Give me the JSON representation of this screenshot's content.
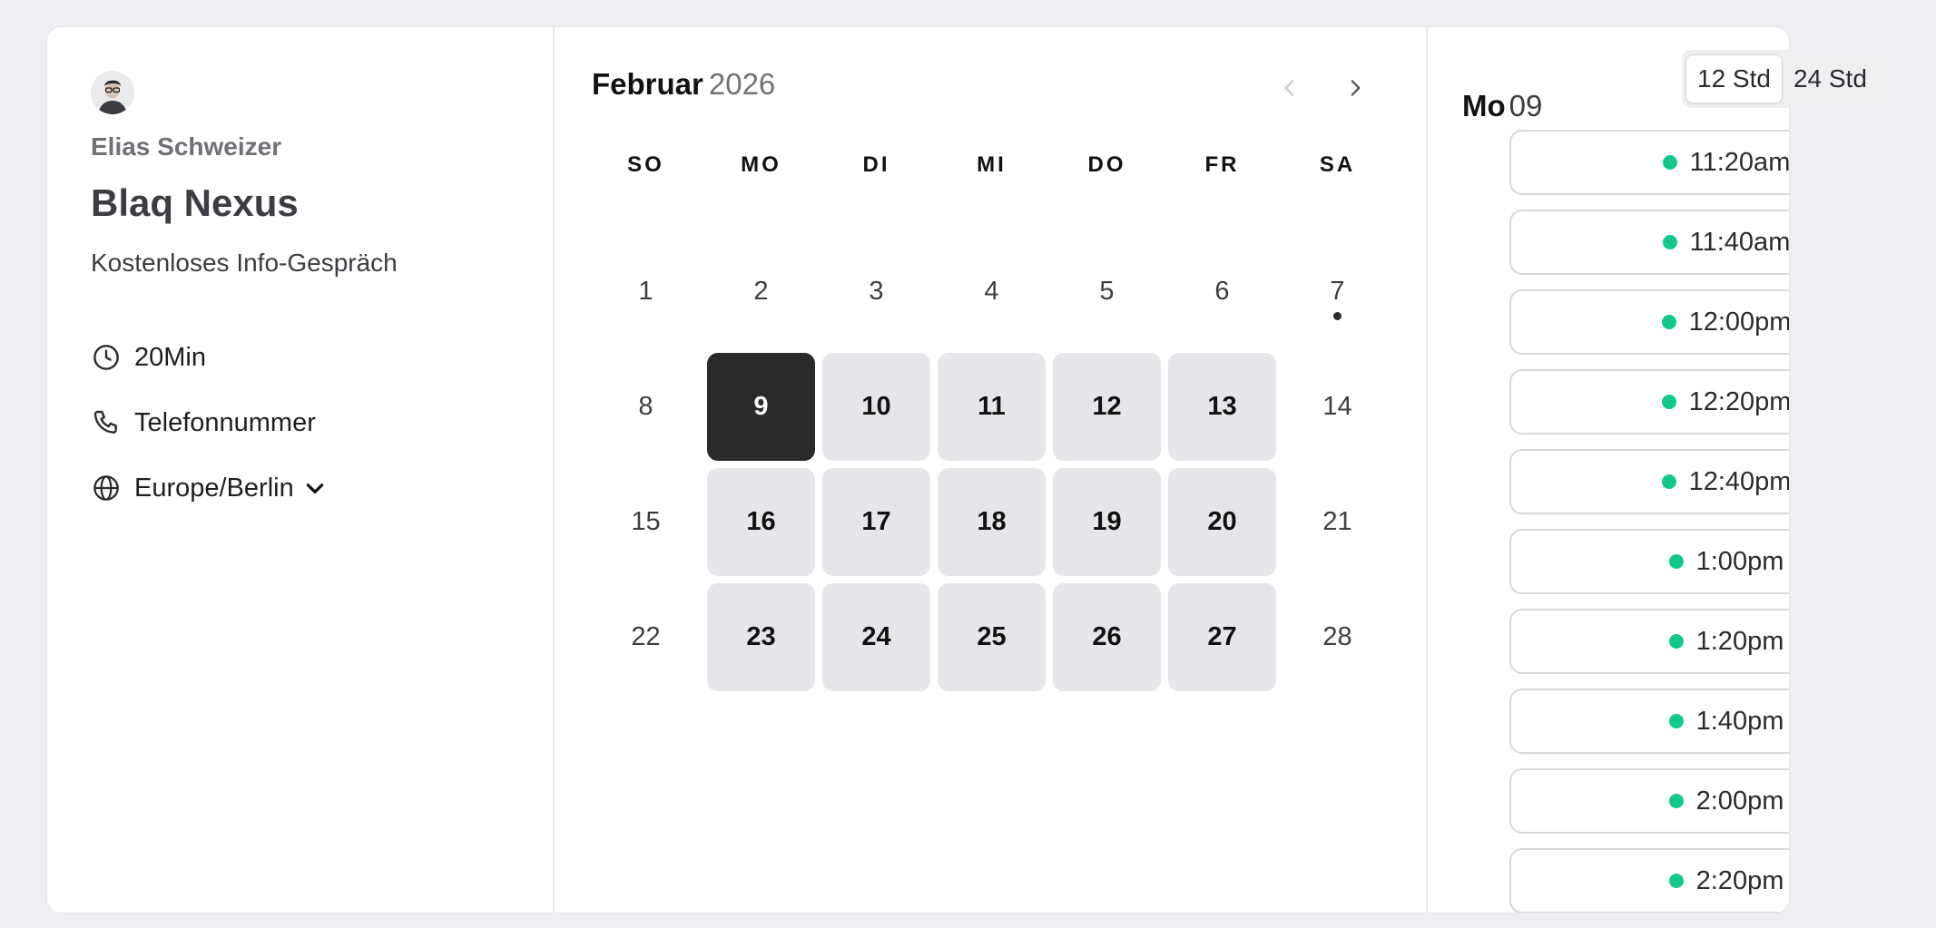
{
  "host": {
    "name": "Elias Schweizer",
    "event_title": "Blaq Nexus",
    "event_description": "Kostenloses Info-Gespräch"
  },
  "details": {
    "duration": "20Min",
    "location": "Telefonnummer",
    "timezone": "Europe/Berlin"
  },
  "calendar": {
    "month": "Februar",
    "year": "2026",
    "weekdays": [
      "SO",
      "MO",
      "DI",
      "MI",
      "DO",
      "FR",
      "SA"
    ],
    "weeks": [
      [
        {
          "d": "1"
        },
        {
          "d": "2"
        },
        {
          "d": "3"
        },
        {
          "d": "4"
        },
        {
          "d": "5"
        },
        {
          "d": "6"
        },
        {
          "d": "7",
          "today": true
        }
      ],
      [
        {
          "d": "8"
        },
        {
          "d": "9",
          "state": "selected"
        },
        {
          "d": "10",
          "state": "available"
        },
        {
          "d": "11",
          "state": "available"
        },
        {
          "d": "12",
          "state": "available"
        },
        {
          "d": "13",
          "state": "available"
        },
        {
          "d": "14"
        }
      ],
      [
        {
          "d": "15"
        },
        {
          "d": "16",
          "state": "available"
        },
        {
          "d": "17",
          "state": "available"
        },
        {
          "d": "18",
          "state": "available"
        },
        {
          "d": "19",
          "state": "available"
        },
        {
          "d": "20",
          "state": "available"
        },
        {
          "d": "21"
        }
      ],
      [
        {
          "d": "22"
        },
        {
          "d": "23",
          "state": "available"
        },
        {
          "d": "24",
          "state": "available"
        },
        {
          "d": "25",
          "state": "available"
        },
        {
          "d": "26",
          "state": "available"
        },
        {
          "d": "27",
          "state": "available"
        },
        {
          "d": "28"
        }
      ]
    ]
  },
  "slots_panel": {
    "day_label": "Mo",
    "day_number": "09",
    "format_options": [
      "12 Std",
      "24 Std"
    ],
    "active_format": "12 Std",
    "times": [
      "11:20am",
      "11:40am",
      "12:00pm",
      "12:20pm",
      "12:40pm",
      "1:00pm",
      "1:20pm",
      "1:40pm",
      "2:00pm",
      "2:20pm"
    ]
  },
  "colors": {
    "available_dot": "#12c98b",
    "selected_day": "#2a2a2a",
    "available_day": "#e5e6e9"
  }
}
